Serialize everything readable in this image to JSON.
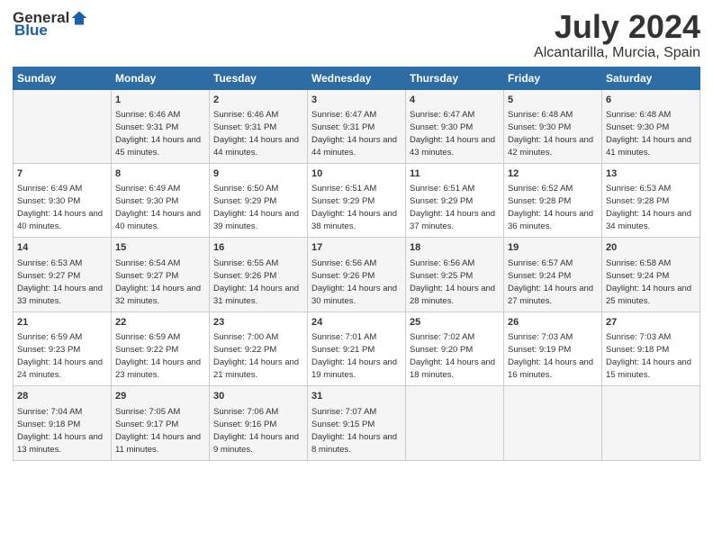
{
  "header": {
    "logo_general": "General",
    "logo_blue": "Blue",
    "title": "July 2024",
    "subtitle": "Alcantarilla, Murcia, Spain"
  },
  "calendar": {
    "days_of_week": [
      "Sunday",
      "Monday",
      "Tuesday",
      "Wednesday",
      "Thursday",
      "Friday",
      "Saturday"
    ],
    "weeks": [
      [
        {
          "day": "",
          "sunrise": "",
          "sunset": "",
          "daylight": ""
        },
        {
          "day": "1",
          "sunrise": "Sunrise: 6:46 AM",
          "sunset": "Sunset: 9:31 PM",
          "daylight": "Daylight: 14 hours and 45 minutes."
        },
        {
          "day": "2",
          "sunrise": "Sunrise: 6:46 AM",
          "sunset": "Sunset: 9:31 PM",
          "daylight": "Daylight: 14 hours and 44 minutes."
        },
        {
          "day": "3",
          "sunrise": "Sunrise: 6:47 AM",
          "sunset": "Sunset: 9:31 PM",
          "daylight": "Daylight: 14 hours and 44 minutes."
        },
        {
          "day": "4",
          "sunrise": "Sunrise: 6:47 AM",
          "sunset": "Sunset: 9:30 PM",
          "daylight": "Daylight: 14 hours and 43 minutes."
        },
        {
          "day": "5",
          "sunrise": "Sunrise: 6:48 AM",
          "sunset": "Sunset: 9:30 PM",
          "daylight": "Daylight: 14 hours and 42 minutes."
        },
        {
          "day": "6",
          "sunrise": "Sunrise: 6:48 AM",
          "sunset": "Sunset: 9:30 PM",
          "daylight": "Daylight: 14 hours and 41 minutes."
        }
      ],
      [
        {
          "day": "7",
          "sunrise": "Sunrise: 6:49 AM",
          "sunset": "Sunset: 9:30 PM",
          "daylight": "Daylight: 14 hours and 40 minutes."
        },
        {
          "day": "8",
          "sunrise": "Sunrise: 6:49 AM",
          "sunset": "Sunset: 9:30 PM",
          "daylight": "Daylight: 14 hours and 40 minutes."
        },
        {
          "day": "9",
          "sunrise": "Sunrise: 6:50 AM",
          "sunset": "Sunset: 9:29 PM",
          "daylight": "Daylight: 14 hours and 39 minutes."
        },
        {
          "day": "10",
          "sunrise": "Sunrise: 6:51 AM",
          "sunset": "Sunset: 9:29 PM",
          "daylight": "Daylight: 14 hours and 38 minutes."
        },
        {
          "day": "11",
          "sunrise": "Sunrise: 6:51 AM",
          "sunset": "Sunset: 9:29 PM",
          "daylight": "Daylight: 14 hours and 37 minutes."
        },
        {
          "day": "12",
          "sunrise": "Sunrise: 6:52 AM",
          "sunset": "Sunset: 9:28 PM",
          "daylight": "Daylight: 14 hours and 36 minutes."
        },
        {
          "day": "13",
          "sunrise": "Sunrise: 6:53 AM",
          "sunset": "Sunset: 9:28 PM",
          "daylight": "Daylight: 14 hours and 34 minutes."
        }
      ],
      [
        {
          "day": "14",
          "sunrise": "Sunrise: 6:53 AM",
          "sunset": "Sunset: 9:27 PM",
          "daylight": "Daylight: 14 hours and 33 minutes."
        },
        {
          "day": "15",
          "sunrise": "Sunrise: 6:54 AM",
          "sunset": "Sunset: 9:27 PM",
          "daylight": "Daylight: 14 hours and 32 minutes."
        },
        {
          "day": "16",
          "sunrise": "Sunrise: 6:55 AM",
          "sunset": "Sunset: 9:26 PM",
          "daylight": "Daylight: 14 hours and 31 minutes."
        },
        {
          "day": "17",
          "sunrise": "Sunrise: 6:56 AM",
          "sunset": "Sunset: 9:26 PM",
          "daylight": "Daylight: 14 hours and 30 minutes."
        },
        {
          "day": "18",
          "sunrise": "Sunrise: 6:56 AM",
          "sunset": "Sunset: 9:25 PM",
          "daylight": "Daylight: 14 hours and 28 minutes."
        },
        {
          "day": "19",
          "sunrise": "Sunrise: 6:57 AM",
          "sunset": "Sunset: 9:24 PM",
          "daylight": "Daylight: 14 hours and 27 minutes."
        },
        {
          "day": "20",
          "sunrise": "Sunrise: 6:58 AM",
          "sunset": "Sunset: 9:24 PM",
          "daylight": "Daylight: 14 hours and 25 minutes."
        }
      ],
      [
        {
          "day": "21",
          "sunrise": "Sunrise: 6:59 AM",
          "sunset": "Sunset: 9:23 PM",
          "daylight": "Daylight: 14 hours and 24 minutes."
        },
        {
          "day": "22",
          "sunrise": "Sunrise: 6:59 AM",
          "sunset": "Sunset: 9:22 PM",
          "daylight": "Daylight: 14 hours and 23 minutes."
        },
        {
          "day": "23",
          "sunrise": "Sunrise: 7:00 AM",
          "sunset": "Sunset: 9:22 PM",
          "daylight": "Daylight: 14 hours and 21 minutes."
        },
        {
          "day": "24",
          "sunrise": "Sunrise: 7:01 AM",
          "sunset": "Sunset: 9:21 PM",
          "daylight": "Daylight: 14 hours and 19 minutes."
        },
        {
          "day": "25",
          "sunrise": "Sunrise: 7:02 AM",
          "sunset": "Sunset: 9:20 PM",
          "daylight": "Daylight: 14 hours and 18 minutes."
        },
        {
          "day": "26",
          "sunrise": "Sunrise: 7:03 AM",
          "sunset": "Sunset: 9:19 PM",
          "daylight": "Daylight: 14 hours and 16 minutes."
        },
        {
          "day": "27",
          "sunrise": "Sunrise: 7:03 AM",
          "sunset": "Sunset: 9:18 PM",
          "daylight": "Daylight: 14 hours and 15 minutes."
        }
      ],
      [
        {
          "day": "28",
          "sunrise": "Sunrise: 7:04 AM",
          "sunset": "Sunset: 9:18 PM",
          "daylight": "Daylight: 14 hours and 13 minutes."
        },
        {
          "day": "29",
          "sunrise": "Sunrise: 7:05 AM",
          "sunset": "Sunset: 9:17 PM",
          "daylight": "Daylight: 14 hours and 11 minutes."
        },
        {
          "day": "30",
          "sunrise": "Sunrise: 7:06 AM",
          "sunset": "Sunset: 9:16 PM",
          "daylight": "Daylight: 14 hours and 9 minutes."
        },
        {
          "day": "31",
          "sunrise": "Sunrise: 7:07 AM",
          "sunset": "Sunset: 9:15 PM",
          "daylight": "Daylight: 14 hours and 8 minutes."
        },
        {
          "day": "",
          "sunrise": "",
          "sunset": "",
          "daylight": ""
        },
        {
          "day": "",
          "sunrise": "",
          "sunset": "",
          "daylight": ""
        },
        {
          "day": "",
          "sunrise": "",
          "sunset": "",
          "daylight": ""
        }
      ]
    ]
  }
}
